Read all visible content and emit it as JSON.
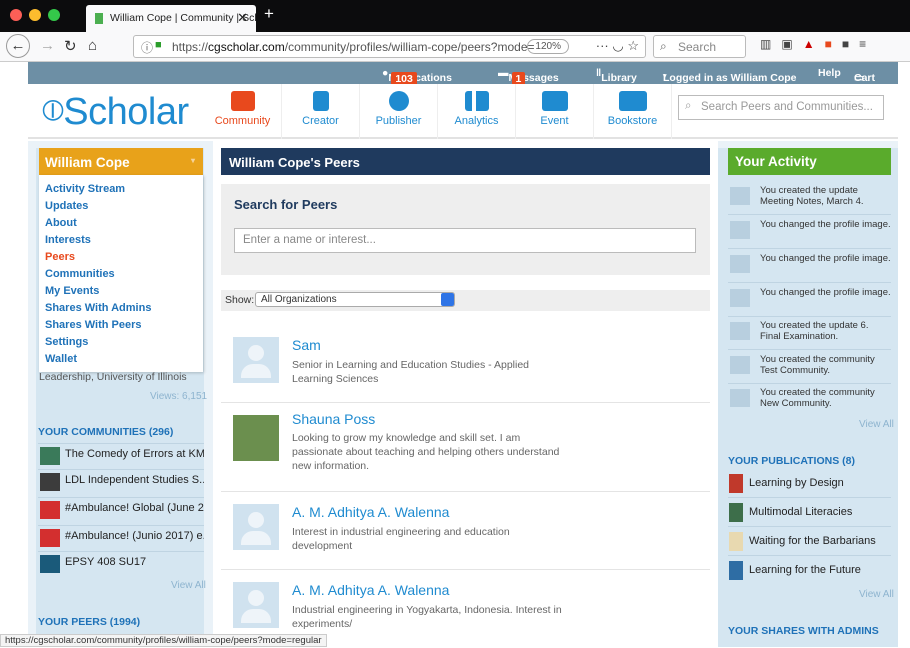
{
  "browser": {
    "tab_title": "William Cope | Community | Sch",
    "url_prefix": "https://",
    "url_host": "cgscholar.com",
    "url_path": "/community/profiles/william-cope/peers?mode=",
    "zoom": "120%",
    "search_placeholder": "Search",
    "status_url": "https://cgscholar.com/community/profiles/william-cope/peers?mode=regular"
  },
  "topbar": {
    "notifications_label": "Notifications",
    "notifications_count": "103",
    "messages_label": "Messages",
    "messages_count": "1",
    "library_label": "Library",
    "logged_in_label": "Logged in as William Cope",
    "help_label": "Help",
    "cart_label": "Cart"
  },
  "header": {
    "logo": "Scholar",
    "modules": [
      {
        "label": "Community",
        "color": "#e8491d"
      },
      {
        "label": "Creator",
        "color": "#1f8bd0"
      },
      {
        "label": "Publisher",
        "color": "#1f8bd0"
      },
      {
        "label": "Analytics",
        "color": "#1f8bd0"
      },
      {
        "label": "Event",
        "color": "#1f8bd0"
      },
      {
        "label": "Bookstore",
        "color": "#1f8bd0"
      }
    ],
    "search_placeholder": "Search Peers and Communities..."
  },
  "left": {
    "user_name": "William Cope",
    "menu": [
      "Activity Stream",
      "Updates",
      "About",
      "Interests",
      "Peers",
      "Communities",
      "My Events",
      "Shares With Admins",
      "Shares With Peers",
      "Settings",
      "Wallet"
    ],
    "active_menu": "Peers",
    "hidden_text": "Leadership, University of Illinois",
    "views": "Views: 6,151",
    "communities_title": "YOUR COMMUNITIES (296)",
    "communities": [
      "The Comedy of Errors at KM...",
      "LDL Independent Studies S...",
      "#Ambulance! Global (June 2...",
      "#Ambulance! (Junio 2017) e...",
      "EPSY 408 SU17"
    ],
    "view_all": "View All",
    "peers_title": "YOUR PEERS (1994)"
  },
  "center": {
    "title": "William Cope's Peers",
    "search_title": "Search for Peers",
    "search_placeholder": "Enter a name or interest...",
    "show_label": "Show:",
    "show_value": "All Organizations",
    "peers": [
      {
        "name": "Sam",
        "desc": "Senior in Learning and Education Studies - Applied Learning Sciences"
      },
      {
        "name": "Shauna Poss",
        "desc": "Looking to grow my knowledge and skill set. I am passionate about teaching and helping others understand new information."
      },
      {
        "name": "A. M. Adhitya A. Walenna",
        "desc": "Interest in industrial engineering and education development"
      },
      {
        "name": "A. M. Adhitya A. Walenna",
        "desc": "Industrial engineering in Yogyakarta, Indonesia. Interest in experiments/"
      }
    ]
  },
  "right": {
    "activity_title": "Your Activity",
    "activities": [
      "You created the update Meeting Notes, March 4.",
      "You changed the profile image.",
      "You changed the profile image.",
      "You changed the profile image.",
      "You created the update 6. Final Examination.",
      "You created the community Test Community.",
      "You created the community New Community."
    ],
    "view_all": "View All",
    "publications_title": "YOUR PUBLICATIONS (8)",
    "publications": [
      "Learning by Design",
      "Multimodal Literacies",
      "Waiting for the Barbarians",
      "Learning for the Future"
    ],
    "shares_title": "YOUR SHARES WITH ADMINS"
  }
}
